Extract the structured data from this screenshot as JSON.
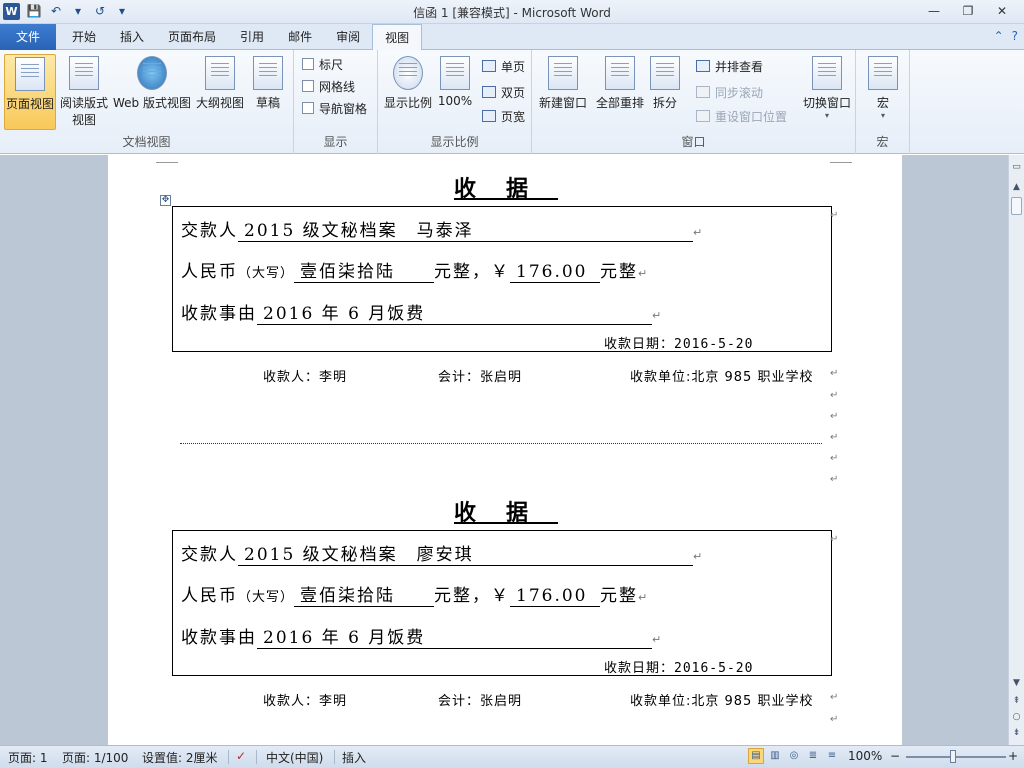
{
  "window": {
    "title": "信函 1 [兼容模式] - Microsoft Word",
    "app_icon_letter": "W",
    "controls": {
      "minimize": "—",
      "restore": "❐",
      "close": "✕"
    }
  },
  "quick_access": {
    "save": "💾",
    "undo": "↶",
    "undo_dropdown": "▾",
    "redo": "↺",
    "customize": "▾"
  },
  "tabs": {
    "file": "文件",
    "items": [
      "开始",
      "插入",
      "页面布局",
      "引用",
      "邮件",
      "审阅",
      "视图"
    ],
    "active": "视图",
    "right_icons": {
      "collapse": "⌃",
      "help": "?"
    }
  },
  "ribbon": {
    "document_views": {
      "label": "文档视图",
      "print_layout": "页面视图",
      "full_reading_1": "阅读版式",
      "full_reading_2": "视图",
      "web_layout": "Web 版式视图",
      "outline": "大纲视图",
      "draft": "草稿"
    },
    "show": {
      "label": "显示",
      "ruler": "标尺",
      "gridlines": "网格线",
      "nav_pane": "导航窗格"
    },
    "zoom": {
      "label": "显示比例",
      "zoom": "显示比例",
      "hundred": "100%",
      "one_page": "单页",
      "two_pages": "双页",
      "page_width": "页宽"
    },
    "window": {
      "label": "窗口",
      "new_window": "新建窗口",
      "arrange_all": "全部重排",
      "split": "拆分",
      "side_by_side": "并排查看",
      "sync_scroll": "同步滚动",
      "reset_position": "重设窗口位置",
      "switch_windows": "切换窗口"
    },
    "macros": {
      "label": "宏",
      "macros": "宏"
    }
  },
  "document": {
    "receipts": [
      {
        "title": "收据",
        "payer_label": "交款人",
        "payer_value": "2015 级文秘档案　马泰泽",
        "rmb_label": "人民币",
        "rmb_small": "（大写）",
        "amount_words": "壹佰柒拾陆",
        "yuan_whole": "元整，",
        "currency_symbol": "￥",
        "amount": "176.00",
        "yuan_whole_2": "元整",
        "reason_label": "收款事由",
        "reason_value": "2016 年 6 月饭费",
        "date": "收款日期：2016-5-20",
        "payee": "收款人：李明",
        "accountant": "会计：张启明",
        "unit": "收款单位:北京 985 职业学校"
      },
      {
        "title": "收据",
        "payer_label": "交款人",
        "payer_value": "2015 级文秘档案　廖安琪",
        "rmb_label": "人民币",
        "rmb_small": "（大写）",
        "amount_words": "壹佰柒拾陆",
        "yuan_whole": "元整，",
        "currency_symbol": "￥",
        "amount": "176.00",
        "yuan_whole_2": "元整",
        "reason_label": "收款事由",
        "reason_value": "2016 年 6 月饭费",
        "date": "收款日期：2016-5-20",
        "payee": "收款人：李明",
        "accountant": "会计：张启明",
        "unit": "收款单位:北京 985 职业学校"
      }
    ],
    "para_mark": "↵"
  },
  "statusbar": {
    "page": "页面: 1",
    "pages": "页面: 1/100",
    "settings": "设置值: 2厘米",
    "language": "中文(中国)",
    "mode": "插入",
    "zoom": "100%",
    "zoom_minus": "−",
    "zoom_plus": "+"
  }
}
